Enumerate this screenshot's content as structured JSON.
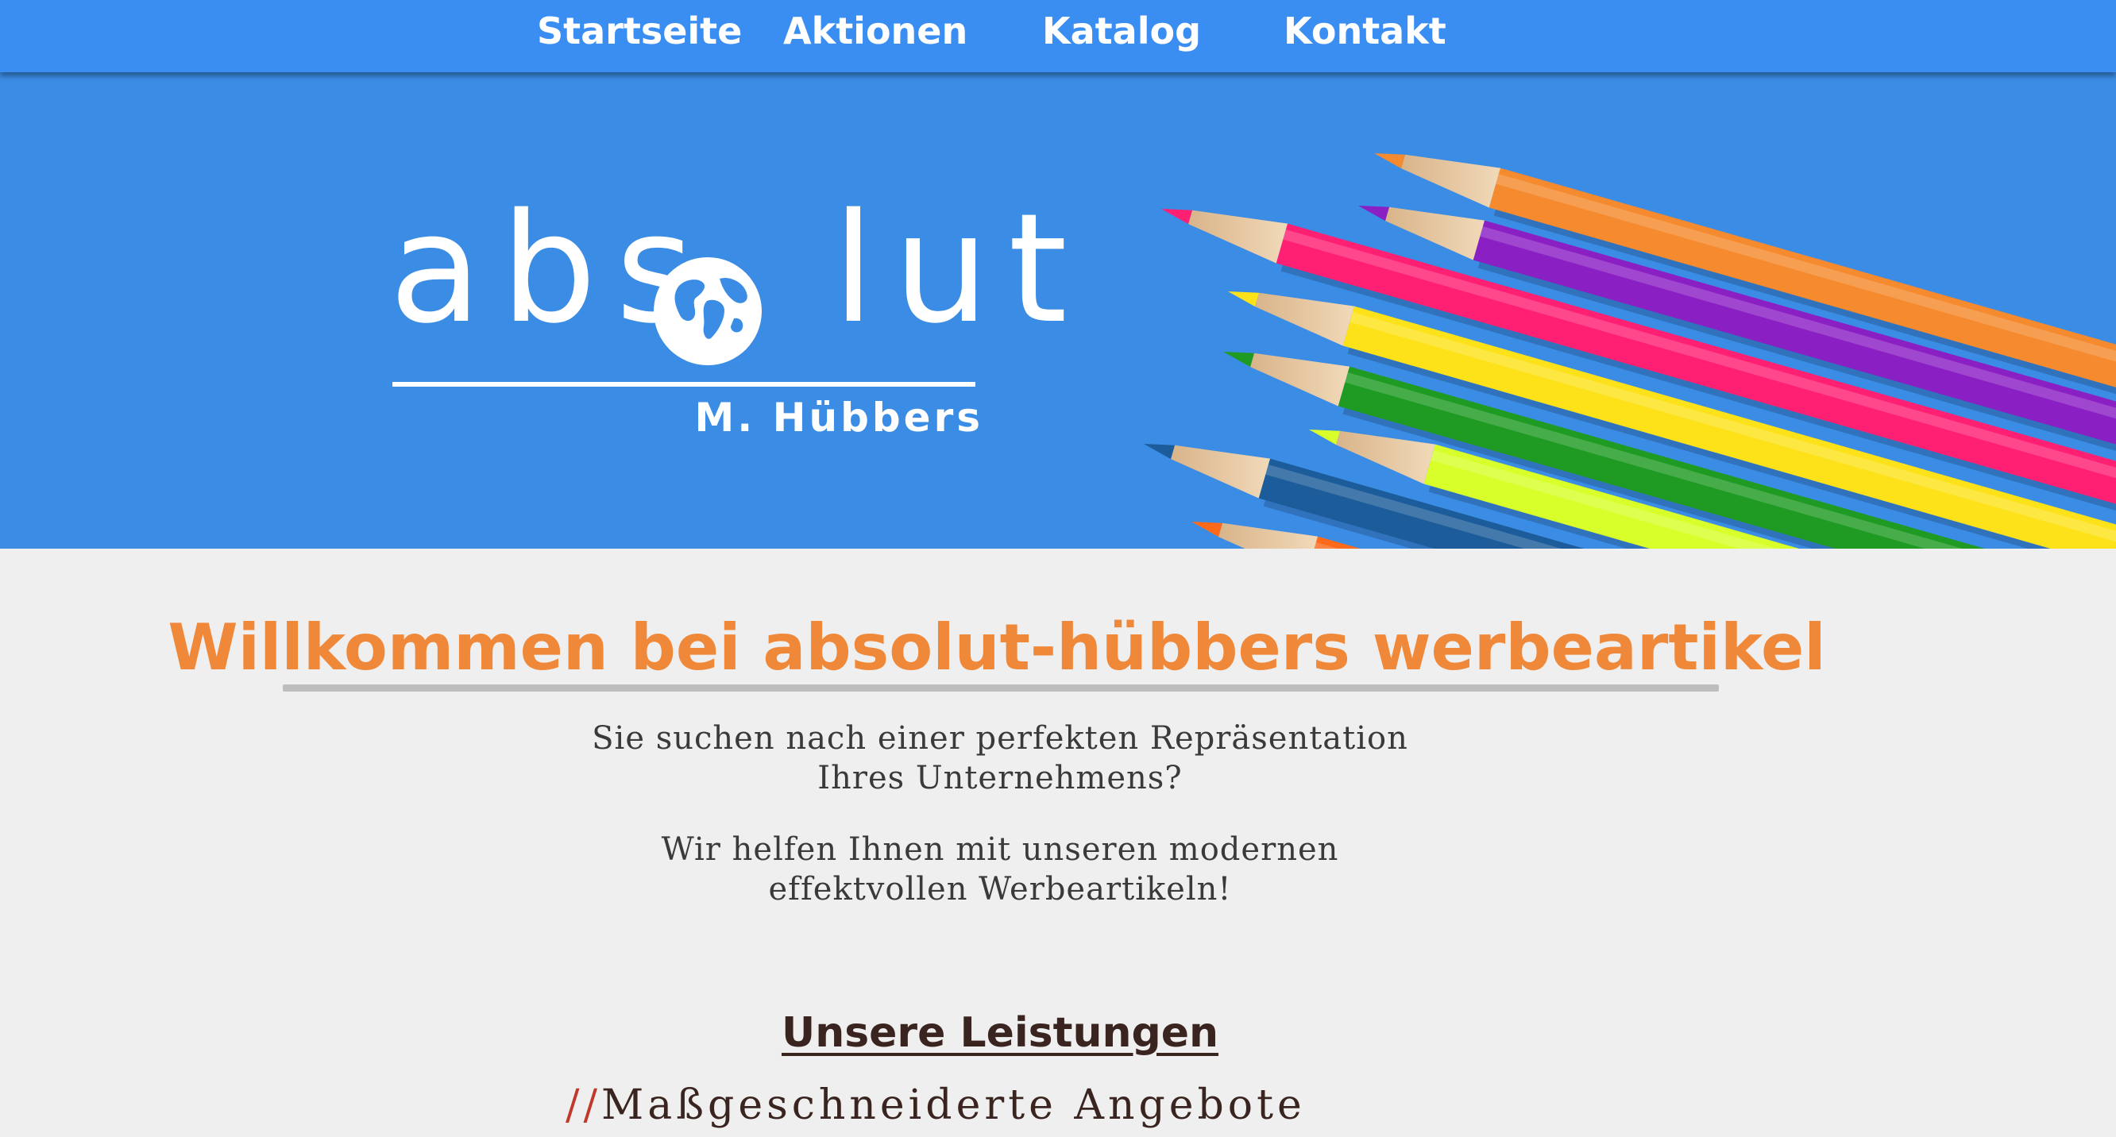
{
  "nav": {
    "items": [
      {
        "label": "Startseite"
      },
      {
        "label": "Aktionen"
      },
      {
        "label": "Katalog"
      },
      {
        "label": "Kontakt"
      }
    ]
  },
  "colors": {
    "nav_bg": "#3a8ef2",
    "hero_bg": "#3b8ce4",
    "heading": "#f0883a",
    "text": "#3a3a3a",
    "dark_text": "#3a2420",
    "slash_accent": "#c0392b",
    "page_bg": "#efefef"
  },
  "hero": {
    "logo": {
      "word_left": "abs",
      "word_right": "lut",
      "subtitle": "M. Hübbers",
      "globe_icon": "globe-icon"
    },
    "pencil_colors": [
      "#f58a2e",
      "#8a1fc4",
      "#ff1f73",
      "#fde21a",
      "#1f9b24",
      "#d8ff2a",
      "#1c5c9a",
      "#ff6a1a"
    ]
  },
  "main": {
    "heading": "Willkommen bei absolut-hübbers werbeartikel",
    "intro_lines": [
      "Sie suchen nach einer perfekten Repräsentation",
      "Ihres Unternehmens?"
    ],
    "help_lines": [
      "Wir helfen Ihnen mit unseren modernen",
      "effektvollen Werbeartikeln!"
    ],
    "services_title": "Unsere Leistungen",
    "service_items": [
      {
        "prefix": "//",
        "label": "Maßgeschneiderte Angebote"
      }
    ]
  }
}
